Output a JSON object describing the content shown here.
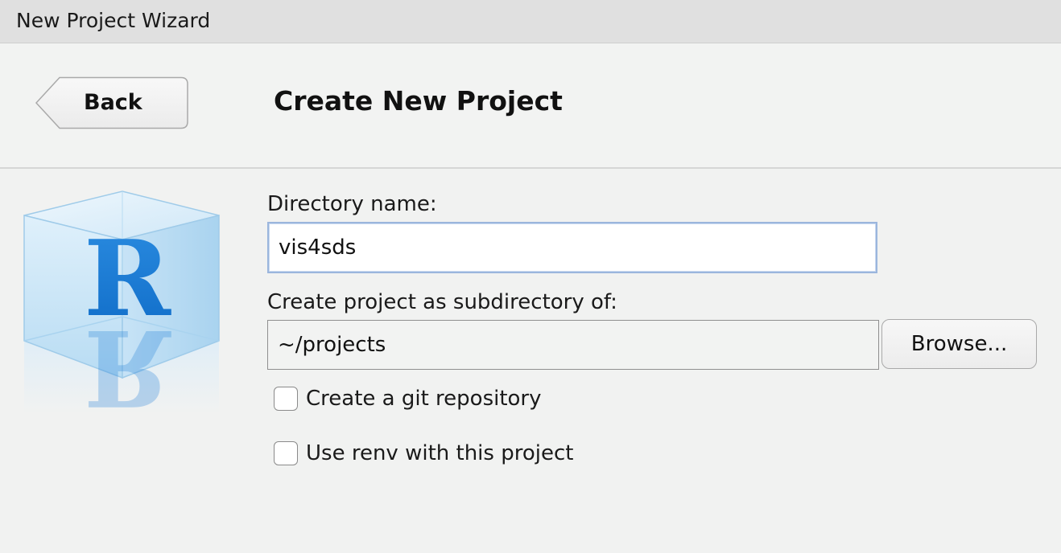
{
  "window": {
    "title": "New Project Wizard"
  },
  "header": {
    "back_label": "Back",
    "page_title": "Create New Project"
  },
  "logo": {
    "letter": "R",
    "icon": "r-cube-logo"
  },
  "form": {
    "directory_name_label": "Directory name:",
    "directory_name_value": "vis4sds",
    "parent_dir_label": "Create project as subdirectory of:",
    "parent_dir_value": "~/projects",
    "browse_label": "Browse...",
    "checkboxes": [
      {
        "label": "Create a git repository",
        "checked": false
      },
      {
        "label": "Use renv with this project",
        "checked": false
      }
    ]
  },
  "colors": {
    "accent": "#9bb6dd",
    "r_blue": "#1f7fd8",
    "titlebar": "#e0e0e0",
    "background": "#f1f2f1"
  }
}
